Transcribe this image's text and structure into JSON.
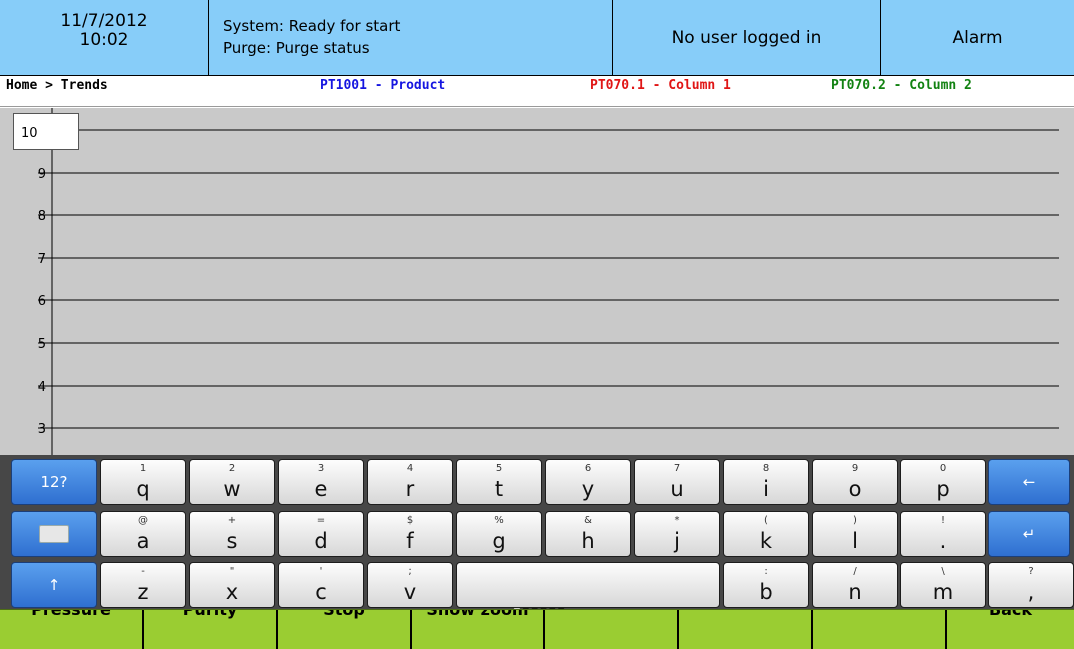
{
  "header": {
    "date": "11/7/2012",
    "time": "10:02",
    "system_status": "System: Ready for start",
    "purge_status": "Purge: Purge status",
    "user": "No user logged in",
    "alarm": "Alarm"
  },
  "breadcrumb": "Home > Trends",
  "legend": [
    {
      "label": "PT1001 - Product",
      "color": "#1515e0"
    },
    {
      "label": "PT070.1 - Column 1",
      "color": "#e01515"
    },
    {
      "label": "PT070.2 - Column 2",
      "color": "#128212"
    }
  ],
  "trend": {
    "ymax_value": "10",
    "y_ticks": [
      "9",
      "8",
      "7",
      "6",
      "5",
      "4",
      "3"
    ],
    "grid": true
  },
  "keyboard": {
    "rows": [
      [
        {
          "type": "fn",
          "label": "12?",
          "name": "key-numeric-toggle"
        },
        {
          "sub": "1",
          "main": "q"
        },
        {
          "sub": "2",
          "main": "w"
        },
        {
          "sub": "3",
          "main": "e"
        },
        {
          "sub": "4",
          "main": "r"
        },
        {
          "sub": "5",
          "main": "t"
        },
        {
          "sub": "6",
          "main": "y"
        },
        {
          "sub": "7",
          "main": "u"
        },
        {
          "sub": "8",
          "main": "i"
        },
        {
          "sub": "9",
          "main": "o"
        },
        {
          "sub": "0",
          "main": "p"
        },
        {
          "type": "fn",
          "icon": "backspace-icon",
          "glyph": "←",
          "name": "key-backspace"
        }
      ],
      [
        {
          "type": "fn",
          "icon": "keyboard-icon",
          "name": "key-hide-keyboard"
        },
        {
          "sub": "@",
          "main": "a"
        },
        {
          "sub": "+",
          "main": "s"
        },
        {
          "sub": "=",
          "main": "d"
        },
        {
          "sub": "$",
          "main": "f"
        },
        {
          "sub": "%",
          "main": "g"
        },
        {
          "sub": "&",
          "main": "h"
        },
        {
          "sub": "*",
          "main": "j"
        },
        {
          "sub": "(",
          "main": "k"
        },
        {
          "sub": ")",
          "main": "l"
        },
        {
          "sub": "!",
          "main": "."
        },
        {
          "type": "fn",
          "icon": "enter-icon",
          "glyph": "↵",
          "name": "key-enter"
        }
      ],
      [
        {
          "type": "fn",
          "icon": "shift-icon",
          "glyph": "↑",
          "name": "key-shift"
        },
        {
          "sub": "-",
          "main": "z"
        },
        {
          "sub": "\"",
          "main": "x"
        },
        {
          "sub": "'",
          "main": "c"
        },
        {
          "sub": ";",
          "main": "v"
        },
        {
          "type": "space",
          "name": "key-space"
        },
        {
          "sub": ":",
          "main": "b"
        },
        {
          "sub": "/",
          "main": "n"
        },
        {
          "sub": "\\",
          "main": "m"
        },
        {
          "sub": "?",
          "main": ","
        }
      ]
    ],
    "page_dots": "●●●●●"
  },
  "bottom_bar": {
    "buttons": [
      "Pressure",
      "Purity",
      "Stop",
      "Show zoom",
      "",
      "",
      "",
      "Back"
    ]
  }
}
